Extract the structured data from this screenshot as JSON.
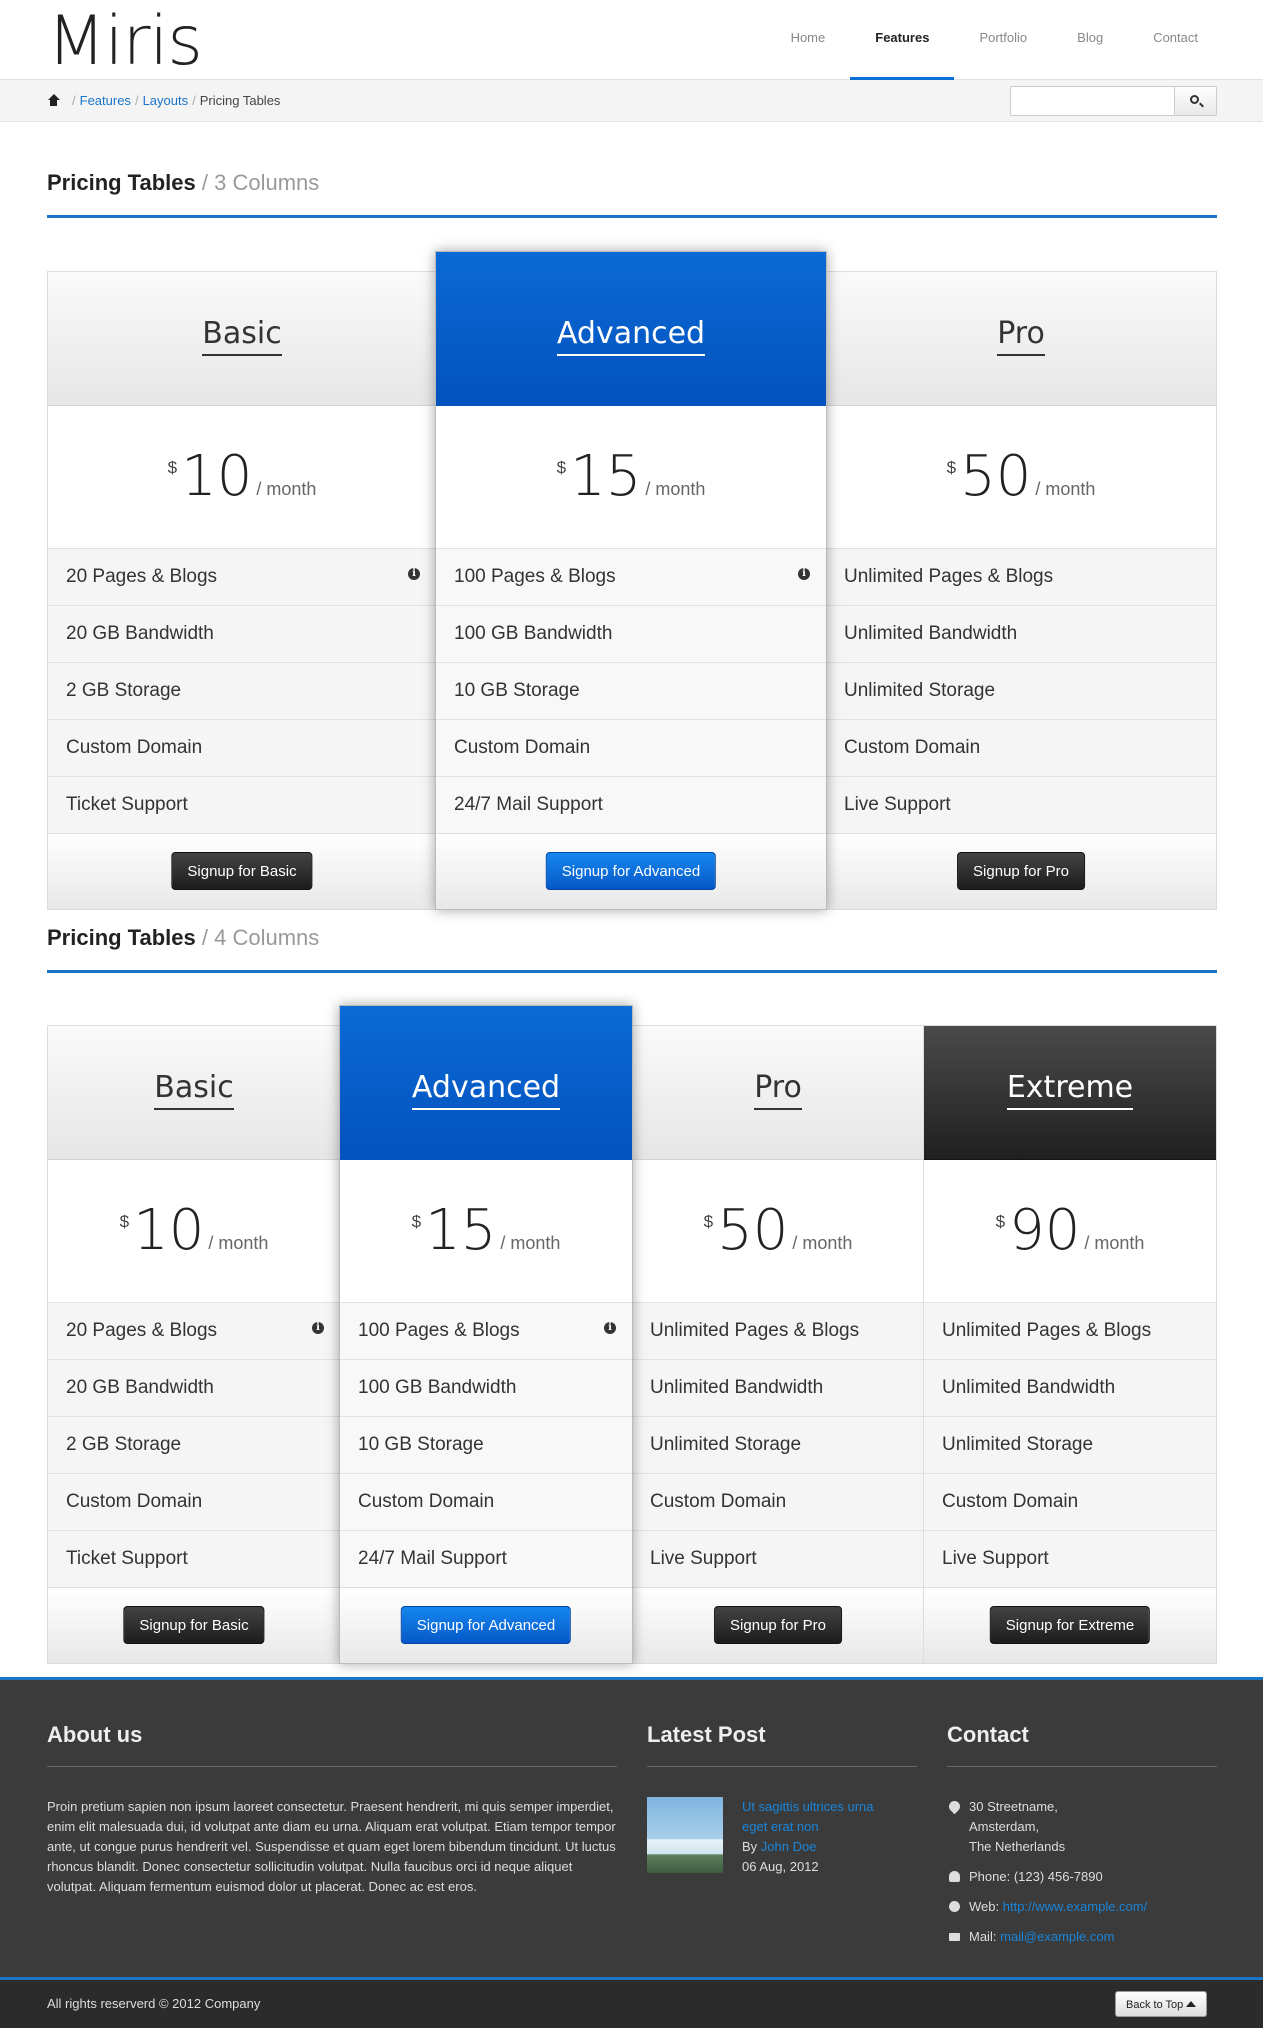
{
  "header": {
    "logo": "Miris",
    "nav": [
      {
        "label": "Home"
      },
      {
        "label": "Features",
        "active": true
      },
      {
        "label": "Portfolio"
      },
      {
        "label": "Blog"
      },
      {
        "label": "Contact"
      }
    ]
  },
  "breadcrumb": {
    "items": [
      "Features",
      "Layouts"
    ],
    "current": "Pricing Tables"
  },
  "section1": {
    "title": "Pricing Tables",
    "subtitle": "/ 3 Columns"
  },
  "section2": {
    "title": "Pricing Tables",
    "subtitle": "/ 4 Columns"
  },
  "plans": {
    "basic": {
      "name": "Basic",
      "currency": "$",
      "price": "10",
      "period": "/ month",
      "features": [
        "20 Pages & Blogs",
        "20 GB Bandwidth",
        "2 GB Storage",
        "Custom Domain",
        "Ticket Support"
      ],
      "button": "Signup for Basic"
    },
    "advanced": {
      "name": "Advanced",
      "currency": "$",
      "price": "15",
      "period": "/ month",
      "features": [
        "100 Pages & Blogs",
        "100 GB Bandwidth",
        "10 GB Storage",
        "Custom Domain",
        "24/7 Mail Support"
      ],
      "button": "Signup for Advanced"
    },
    "pro": {
      "name": "Pro",
      "currency": "$",
      "price": "50",
      "period": "/ month",
      "features": [
        "Unlimited Pages & Blogs",
        "Unlimited Bandwidth",
        "Unlimited Storage",
        "Custom Domain",
        "Live Support"
      ],
      "button": "Signup for Pro"
    },
    "extreme": {
      "name": "Extreme",
      "currency": "$",
      "price": "90",
      "period": "/ month",
      "features": [
        "Unlimited Pages & Blogs",
        "Unlimited Bandwidth",
        "Unlimited Storage",
        "Custom Domain",
        "Live Support"
      ],
      "button": "Signup for Extreme"
    }
  },
  "footer": {
    "about": {
      "title": "About us",
      "text": "Proin pretium sapien non ipsum laoreet consectetur. Praesent hendrerit, mi quis semper imperdiet, enim elit malesuada dui, id volutpat ante diam eu urna. Aliquam erat volutpat. Etiam tempor tempor ante, ut congue purus hendrerit vel. Suspendisse et quam eget lorem bibendum tincidunt. Ut luctus rhoncus blandit. Donec consectetur sollicitudin volutpat. Nulla faucibus orci id neque aliquet volutpat. Aliquam fermentum euismod dolor ut placerat. Donec ac est eros."
    },
    "latest": {
      "title": "Latest Post",
      "post_title": "Ut sagittis ultrices urna eget erat non",
      "by": "By",
      "author": "John Doe",
      "date": "06 Aug, 2012"
    },
    "contact": {
      "title": "Contact",
      "address1": "30 Streetname,",
      "address2": "Amsterdam,",
      "address3": "The Netherlands",
      "phone": "Phone: (123) 456-7890",
      "web_label": "Web:",
      "web": "http://www.example.com/",
      "mail_label": "Mail:",
      "mail": "mail@example.com"
    },
    "copyright": "All rights reserverd © 2012 Company",
    "back_to_top": "Back to Top"
  },
  "colors": {
    "accent": "#1a75c9",
    "featured": "#0452bd",
    "dark": "#222222"
  }
}
